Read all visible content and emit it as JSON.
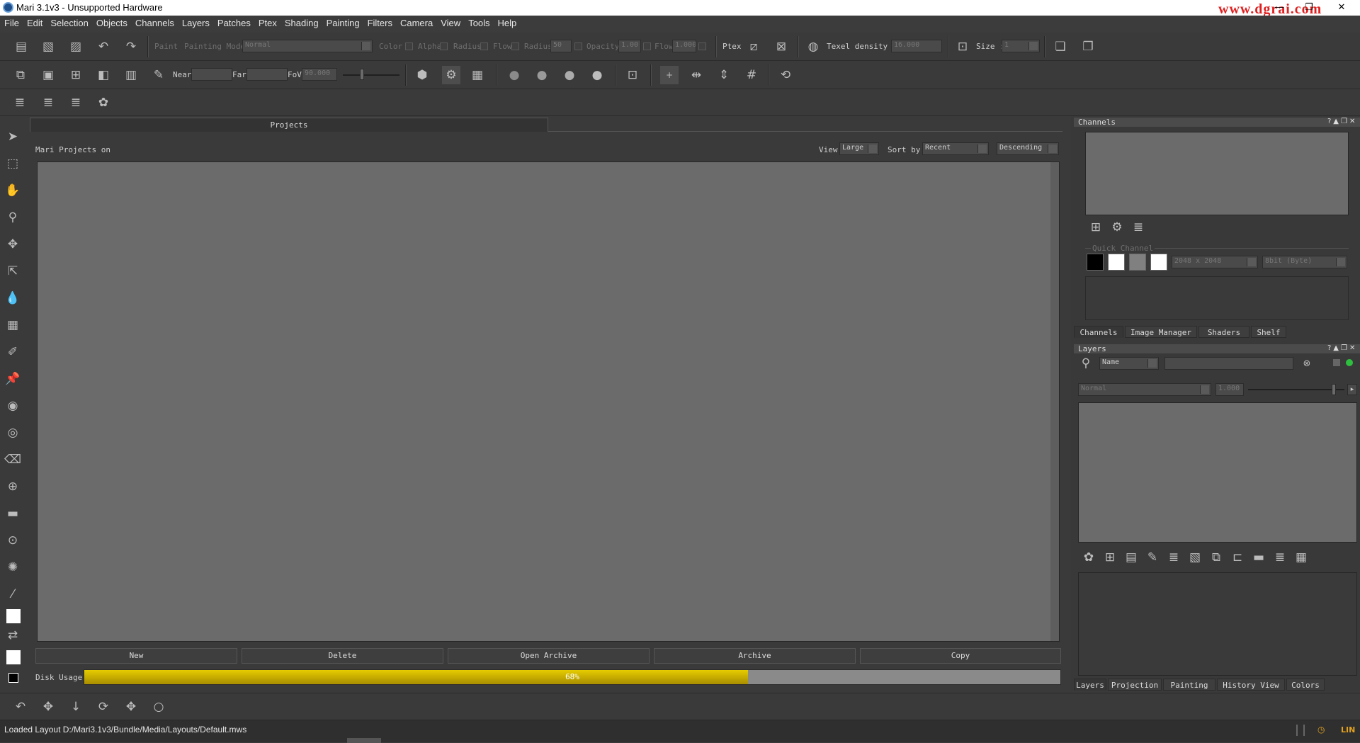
{
  "window": {
    "title": "Mari 3.1v3 - Unsupported Hardware",
    "watermark": "www.dgrai.com",
    "minimize": "—",
    "restore": "❐",
    "close": "✕"
  },
  "menu": [
    "File",
    "Edit",
    "Selection",
    "Objects",
    "Channels",
    "Layers",
    "Patches",
    "Ptex",
    "Shading",
    "Painting",
    "Filters",
    "Camera",
    "View",
    "Tools",
    "Help"
  ],
  "toolbar1": {
    "paint_label": "Paint",
    "painting_mode_label": "Painting Mode",
    "painting_mode_value": "Normal",
    "color_label": "Color",
    "alpha_label": "Alpha",
    "radius_check_label": "Radius",
    "flow_check_label": "Flow",
    "radius_label": "Radius",
    "radius_value": "50",
    "opacity_label": "Opacity",
    "opacity_value": "1.00",
    "flow_label": "Flow",
    "flow_value": "1.000",
    "ptex_label": "Ptex",
    "texel_density_label": "Texel density :",
    "texel_density_value": "16.000",
    "size_label": "Size :",
    "size_value": "1"
  },
  "toolbar2": {
    "near_label": "Near",
    "far_label": "Far",
    "fov_label": "FoV",
    "fov_value": "90.000"
  },
  "projects": {
    "tab": "Projects",
    "header_text": "Mari Projects on",
    "view_label": "View",
    "view_value": "Large",
    "sort_label": "Sort by",
    "sort_value": "Recent",
    "order_value": "Descending",
    "buttons": [
      "New",
      "Delete",
      "Open Archive",
      "Archive",
      "Copy"
    ],
    "disk_usage_label": "Disk Usage",
    "disk_usage_percent": 68,
    "disk_usage_text": "68%"
  },
  "channels_panel": {
    "title": "Channels",
    "quick_channel_label": "Quick Channel",
    "resolution_value": "2048 x 2048",
    "depth_value": "8bit (Byte)",
    "tabs": [
      "Channels",
      "Image Manager",
      "Shaders",
      "Shelf"
    ]
  },
  "layers_panel": {
    "title": "Layers",
    "filter_value": "Name",
    "blend_value": "Normal",
    "opacity_value": "1.000",
    "tabs": [
      "Layers",
      "Projection",
      "Painting",
      "History View",
      "Colors"
    ]
  },
  "colors": {
    "accent": "#c8a800",
    "progress_bg": "#8a8a8a",
    "view_bg": "#6b6b6b",
    "status_green": "#2fbf3f"
  },
  "status": {
    "message": "Loaded Layout D:/Mari3.1v3/Bundle/Media/Layouts/Default.mws",
    "tray": "LIN"
  }
}
